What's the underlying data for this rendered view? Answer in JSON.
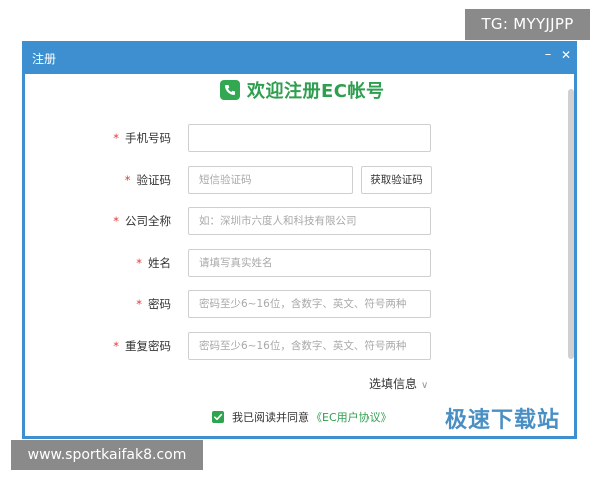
{
  "watermark_top": "TG: MYYJJPP",
  "watermark_bottom": "www.sportkaifak8.com",
  "window": {
    "title": "注册",
    "minimize_glyph": "–",
    "close_glyph": "✕",
    "accent_color": "#3d8fcf"
  },
  "header": {
    "title": "欢迎注册EC帐号",
    "logo_icon": "phone-icon",
    "brand_color": "#2e9e4f"
  },
  "form": {
    "required_mark": "*",
    "phone": {
      "label": "手机号码",
      "value": "",
      "placeholder": ""
    },
    "code": {
      "label": "验证码",
      "value": "",
      "placeholder": "短信验证码",
      "button": "获取验证码"
    },
    "company": {
      "label": "公司全称",
      "value": "",
      "placeholder": "如：深圳市六度人和科技有限公司"
    },
    "name": {
      "label": "姓名",
      "value": "",
      "placeholder": "请填写真实姓名"
    },
    "password": {
      "label": "密码",
      "value": "",
      "placeholder": "密码至少6~16位，含数字、英文、符号两种"
    },
    "password_repeat": {
      "label": "重复密码",
      "value": "",
      "placeholder": "密码至少6~16位，含数字、英文、符号两种"
    }
  },
  "optional": {
    "label": "选填信息",
    "icon": "chevron-down-icon"
  },
  "agreement": {
    "checked": true,
    "text": "我已阅读并同意",
    "link": "《EC用户协议》"
  },
  "brand_watermark": "极速下载站"
}
